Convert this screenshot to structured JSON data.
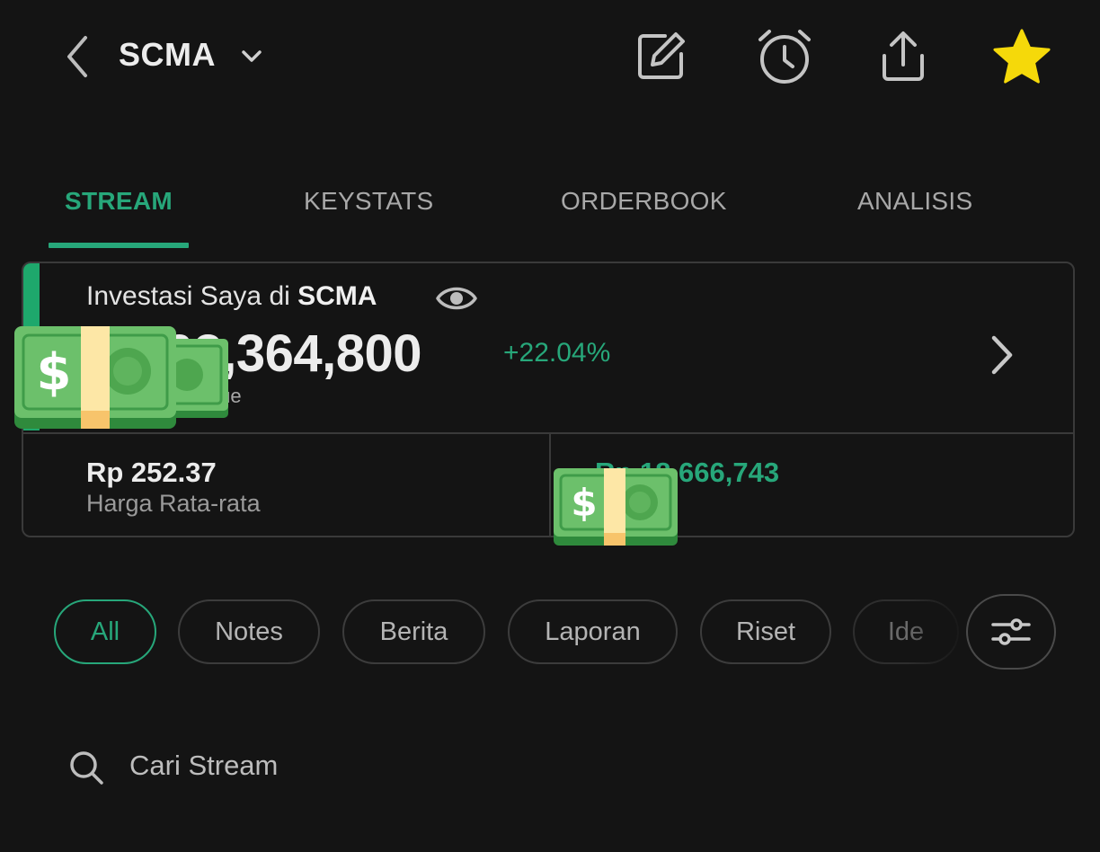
{
  "header": {
    "ticker": "SCMA",
    "icons": [
      "back-icon",
      "chevron-down-icon",
      "edit-icon",
      "alarm-icon",
      "share-icon",
      "star-icon"
    ]
  },
  "tabs": [
    {
      "label": "STREAM",
      "active": true
    },
    {
      "label": "KEYSTATS",
      "active": false
    },
    {
      "label": "ORDERBOOK",
      "active": false
    },
    {
      "label": "ANALISIS",
      "active": false
    }
  ],
  "investment": {
    "title_prefix": "Investasi Saya di ",
    "title_ticker": "SCMA",
    "value": "Rp 103,364,800",
    "change": "+22.04%",
    "value_sub": "Value",
    "avg_price": "Rp 252.37",
    "avg_price_label": "Harga Rata-rata",
    "profit_loss": "Rp 18,666,743"
  },
  "filters": [
    {
      "label": "All",
      "active": true
    },
    {
      "label": "Notes",
      "active": false
    },
    {
      "label": "Berita",
      "active": false
    },
    {
      "label": "Laporan",
      "active": false
    },
    {
      "label": "Riset",
      "active": false
    },
    {
      "label": "Ide",
      "active": false
    }
  ],
  "search": {
    "placeholder": "Cari Stream"
  },
  "colors": {
    "accent": "#27a77a",
    "star": "#f5d90a",
    "background": "#141414"
  }
}
